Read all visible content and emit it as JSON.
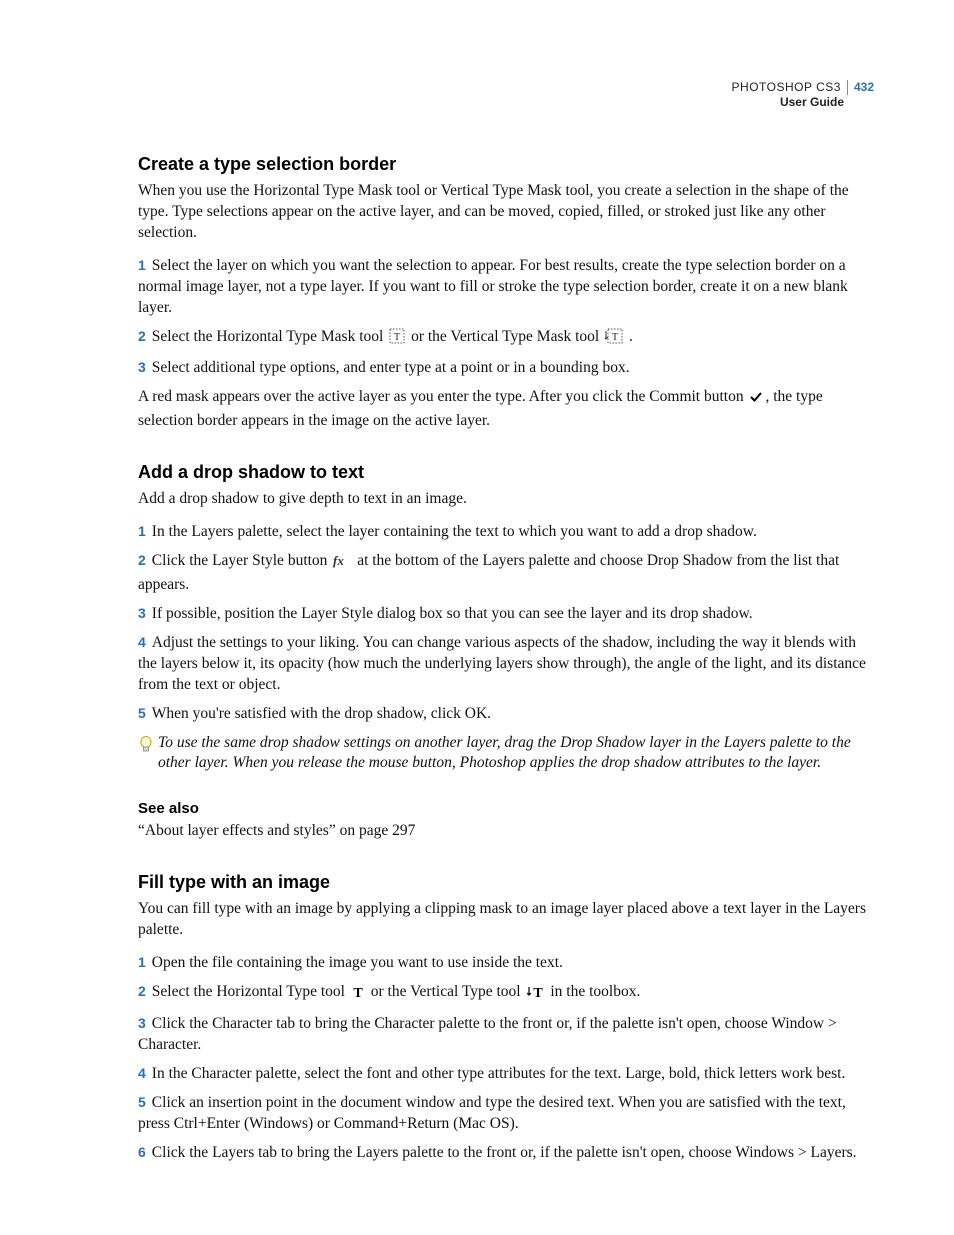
{
  "header": {
    "product": "PHOTOSHOP CS3",
    "page_number": "432",
    "subtitle": "User Guide"
  },
  "sections": [
    {
      "heading": "Create a type selection border",
      "intro": "When you use the Horizontal Type Mask tool or Vertical Type Mask tool, you create a selection in the shape of the type. Type selections appear on the active layer, and can be moved, copied, filled, or stroked just like any other selection.",
      "steps": [
        {
          "n": "1",
          "text": "Select the layer on which you want the selection to appear. For best results, create the type selection border on a normal image layer, not a type layer. If you want to fill or stroke the type selection border, create it on a new blank layer."
        },
        {
          "n": "2",
          "pre": "Select the Horizontal Type Mask tool ",
          "icon1": "htypemask",
          "mid": " or the Vertical Type Mask tool ",
          "icon2": "vtypemask",
          "post": "."
        },
        {
          "n": "3",
          "text": "Select additional type options, and enter type at a point or in a bounding box."
        }
      ],
      "after_pre": "A red mask appears over the active layer as you enter the type. After you click the Commit button ",
      "after_icon": "commit",
      "after_post": ", the type selection border appears in the image on the active layer."
    },
    {
      "heading": "Add a drop shadow to text",
      "intro": "Add a drop shadow to give depth to text in an image.",
      "steps": [
        {
          "n": "1",
          "text": "In the Layers palette, select the layer containing the text to which you want to add a drop shadow."
        },
        {
          "n": "2",
          "pre": "Click the Layer Style button ",
          "icon1": "fx",
          "post": " at the bottom of the Layers palette and choose Drop Shadow from the list that appears."
        },
        {
          "n": "3",
          "text": "If possible, position the Layer Style dialog box so that you can see the layer and its drop shadow."
        },
        {
          "n": "4",
          "text": "Adjust the settings to your liking. You can change various aspects of the shadow, including the way it blends with the layers below it, its opacity (how much the underlying layers show through), the angle of the light, and its distance from the text or object."
        },
        {
          "n": "5",
          "text": "When you're satisfied with the drop shadow, click OK."
        }
      ],
      "tip": "To use the same drop shadow settings on another layer, drag the Drop Shadow layer in the Layers palette to the other layer. When you release the mouse button, Photoshop applies the drop shadow attributes to the layer.",
      "see_also_label": "See also",
      "see_also_item": "“About layer effects and styles” on page 297"
    },
    {
      "heading": "Fill type with an image",
      "intro": "You can fill type with an image by applying a clipping mask to an image layer placed above a text layer in the Layers palette.",
      "steps": [
        {
          "n": "1",
          "text": "Open the file containing the image you want to use inside the text."
        },
        {
          "n": "2",
          "pre": "Select the Horizontal Type tool ",
          "icon1": "htype",
          "mid": " or the Vertical Type tool ",
          "icon2": "vtype",
          "post": " in the toolbox."
        },
        {
          "n": "3",
          "text": "Click the Character tab to bring the Character palette to the front or, if the palette isn't open, choose Window > Character."
        },
        {
          "n": "4",
          "text": "In the Character palette, select the font and other type attributes for the text. Large, bold, thick letters work best."
        },
        {
          "n": "5",
          "text": "Click an insertion point in the document window and type the desired text. When you are satisfied with the text, press Ctrl+Enter (Windows) or Command+Return (Mac OS)."
        },
        {
          "n": "6",
          "text": "Click the Layers tab to bring the Layers palette to the front or, if the palette isn't open, choose Windows > Layers."
        }
      ]
    }
  ]
}
